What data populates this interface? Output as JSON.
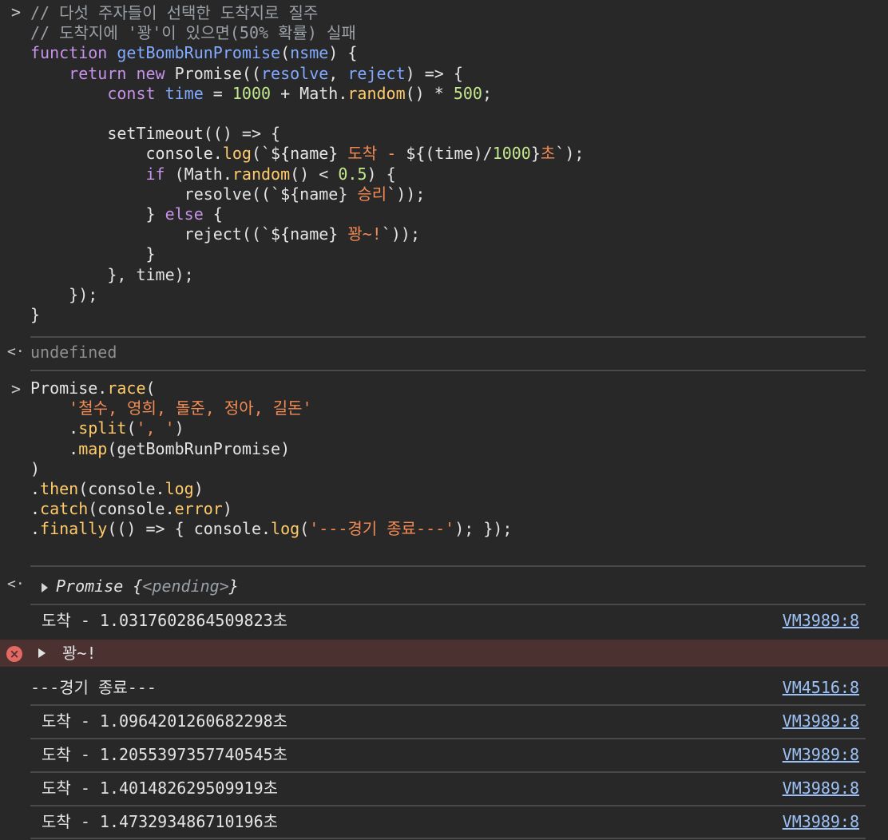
{
  "prompt_symbol": ">",
  "return_symbol": "<·",
  "block1": {
    "lines": [
      [
        [
          "cm",
          "// 다섯 주자들이 선택한 도착지로 질주"
        ]
      ],
      [
        [
          "cm",
          "// 도착지에 '꽝'이 있으면(50% 확률) 실패"
        ]
      ],
      [
        [
          "kw",
          "function "
        ],
        [
          "fn",
          "getBombRunPromise"
        ],
        [
          "id",
          "("
        ],
        [
          "prm",
          "nsme"
        ],
        [
          "id",
          ") {"
        ]
      ],
      [
        [
          "id",
          "    "
        ],
        [
          "kw",
          "return new "
        ],
        [
          "id",
          "Promise(("
        ],
        [
          "prm",
          "resolve"
        ],
        [
          "id",
          ", "
        ],
        [
          "prm",
          "reject"
        ],
        [
          "id",
          ") => {"
        ]
      ],
      [
        [
          "id",
          "        "
        ],
        [
          "kw",
          "const "
        ],
        [
          "prm",
          "time"
        ],
        [
          "id",
          " = "
        ],
        [
          "num",
          "1000"
        ],
        [
          "id",
          " + Math."
        ],
        [
          "pr",
          "random"
        ],
        [
          "id",
          "() * "
        ],
        [
          "num",
          "500"
        ],
        [
          "id",
          ";"
        ]
      ],
      [
        [
          "id",
          ""
        ]
      ],
      [
        [
          "id",
          "        setTimeout(() => {"
        ]
      ],
      [
        [
          "id",
          "            console."
        ],
        [
          "pr",
          "log"
        ],
        [
          "id",
          "(`${name} "
        ],
        [
          "str",
          "도착 - "
        ],
        [
          "id",
          "${(time)/"
        ],
        [
          "num",
          "1000"
        ],
        [
          "id",
          "}"
        ],
        [
          "str",
          "초"
        ],
        [
          "id",
          "`);"
        ]
      ],
      [
        [
          "id",
          "            "
        ],
        [
          "kw",
          "if"
        ],
        [
          "id",
          " (Math."
        ],
        [
          "pr",
          "random"
        ],
        [
          "id",
          "() < "
        ],
        [
          "num",
          "0.5"
        ],
        [
          "id",
          ") {"
        ]
      ],
      [
        [
          "id",
          "                resolve((`${name} "
        ],
        [
          "str",
          "승리"
        ],
        [
          "id",
          "`));"
        ]
      ],
      [
        [
          "id",
          "            } "
        ],
        [
          "kw",
          "else"
        ],
        [
          "id",
          " {"
        ]
      ],
      [
        [
          "id",
          "                reject((`${name} "
        ],
        [
          "str",
          "꽝~!"
        ],
        [
          "id",
          "`));"
        ]
      ],
      [
        [
          "id",
          "            }"
        ]
      ],
      [
        [
          "id",
          "        }, time);"
        ]
      ],
      [
        [
          "id",
          "    });"
        ]
      ],
      [
        [
          "id",
          "}"
        ]
      ]
    ]
  },
  "undefined_text": "undefined",
  "block2": {
    "lines": [
      [
        [
          "id",
          "Promise."
        ],
        [
          "pr",
          "race"
        ],
        [
          "id",
          "("
        ]
      ],
      [
        [
          "id",
          "    "
        ],
        [
          "str",
          "'철수, 영희, 돌준, 정아, 길돈'"
        ]
      ],
      [
        [
          "id",
          "    ."
        ],
        [
          "pr",
          "split"
        ],
        [
          "id",
          "("
        ],
        [
          "str",
          "', '"
        ],
        [
          "id",
          ")"
        ]
      ],
      [
        [
          "id",
          "    ."
        ],
        [
          "pr",
          "map"
        ],
        [
          "id",
          "(getBombRunPromise)"
        ]
      ],
      [
        [
          "id",
          ")"
        ]
      ],
      [
        [
          "id",
          "."
        ],
        [
          "pr",
          "then"
        ],
        [
          "id",
          "(console."
        ],
        [
          "pr",
          "log"
        ],
        [
          "id",
          ")"
        ]
      ],
      [
        [
          "id",
          "."
        ],
        [
          "pr",
          "catch"
        ],
        [
          "id",
          "(console."
        ],
        [
          "pr",
          "error"
        ],
        [
          "id",
          ")"
        ]
      ],
      [
        [
          "id",
          "."
        ],
        [
          "pr",
          "finally"
        ],
        [
          "id",
          "(() => { console."
        ],
        [
          "pr",
          "log"
        ],
        [
          "id",
          "("
        ],
        [
          "str",
          "'---경기 종료---'"
        ],
        [
          "id",
          "); });"
        ]
      ]
    ]
  },
  "promise_result": {
    "label": "Promise",
    "open": " {",
    "state": "<pending>",
    "close": "}"
  },
  "logs": [
    {
      "text": "도착 - 1.0317602864509823초",
      "link": "VM3989:8"
    },
    {
      "text": "꽝~!",
      "error": true
    },
    {
      "text": "---경기 종료---",
      "link": "VM4516:8"
    },
    {
      "text": "도착 - 1.0964201260682298초",
      "link": "VM3989:8"
    },
    {
      "text": "도착 - 1.2055397357740545초",
      "link": "VM3989:8"
    },
    {
      "text": "도착 - 1.401482629509919초",
      "link": "VM3989:8"
    },
    {
      "text": "도착 - 1.473293486710196초",
      "link": "VM3989:8"
    }
  ],
  "error_icon": "×"
}
